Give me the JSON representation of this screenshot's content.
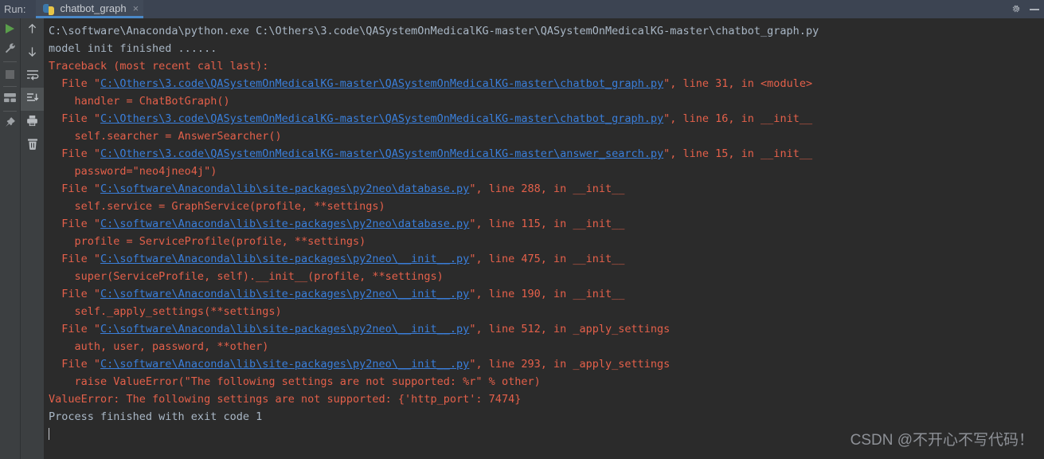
{
  "header": {
    "run_label": "Run:",
    "tab": {
      "label": "chatbot_graph",
      "close_glyph": "×",
      "icon_name": "python-file-icon"
    },
    "settings_icon": "gear-icon",
    "minimize_icon": "minimize-icon",
    "bg_color": "#3c4452",
    "tab_underline_color": "#4a88c7"
  },
  "toolbar_left": {
    "items": [
      {
        "name": "rerun-button",
        "icon": "play-icon"
      },
      {
        "name": "edit-configurations-button",
        "icon": "wrench-icon"
      },
      {
        "name": "stop-button",
        "icon": "stop-square-icon"
      },
      {
        "name": "layout-settings-button",
        "icon": "layout-icon"
      },
      {
        "name": "pin-tab-button",
        "icon": "pin-icon"
      }
    ]
  },
  "toolbar_console": {
    "items": [
      {
        "name": "up-the-stack-trace-button",
        "icon": "arrow-up-icon",
        "active": false
      },
      {
        "name": "down-the-stack-trace-button",
        "icon": "arrow-down-icon",
        "active": false
      },
      {
        "name": "soft-wrap-button",
        "icon": "soft-wrap-icon",
        "active": false
      },
      {
        "name": "scroll-to-end-button",
        "icon": "scroll-to-end-icon",
        "active": true
      },
      {
        "name": "print-button",
        "icon": "printer-icon",
        "active": false
      },
      {
        "name": "clear-all-button",
        "icon": "trash-icon",
        "active": false
      }
    ]
  },
  "console": {
    "bg_color": "#2b2b2b",
    "text_color": "#a9b7c6",
    "error_color": "#e4604a",
    "link_color": "#3a7fdb",
    "lines": [
      {
        "type": "info",
        "parts": [
          {
            "t": "C:\\software\\Anaconda\\python.exe C:\\Others\\3.code\\QASystemOnMedicalKG-master\\QASystemOnMedicalKG-master\\chatbot_graph.py"
          }
        ]
      },
      {
        "type": "info",
        "parts": [
          {
            "t": "model init finished ......"
          }
        ]
      },
      {
        "type": "err",
        "parts": [
          {
            "t": "Traceback (most recent call last):"
          }
        ]
      },
      {
        "type": "err",
        "parts": [
          {
            "t": "  File \""
          },
          {
            "t": "C:\\Others\\3.code\\QASystemOnMedicalKG-master\\QASystemOnMedicalKG-master\\chatbot_graph.py",
            "link": true
          },
          {
            "t": "\", line 31, in <module>"
          }
        ]
      },
      {
        "type": "err",
        "parts": [
          {
            "t": "    handler = ChatBotGraph()"
          }
        ]
      },
      {
        "type": "err",
        "parts": [
          {
            "t": "  File \""
          },
          {
            "t": "C:\\Others\\3.code\\QASystemOnMedicalKG-master\\QASystemOnMedicalKG-master\\chatbot_graph.py",
            "link": true
          },
          {
            "t": "\", line 16, in __init__"
          }
        ]
      },
      {
        "type": "err",
        "parts": [
          {
            "t": "    self.searcher = AnswerSearcher()"
          }
        ]
      },
      {
        "type": "err",
        "parts": [
          {
            "t": "  File \""
          },
          {
            "t": "C:\\Others\\3.code\\QASystemOnMedicalKG-master\\QASystemOnMedicalKG-master\\answer_search.py",
            "link": true
          },
          {
            "t": "\", line 15, in __init__"
          }
        ]
      },
      {
        "type": "err",
        "parts": [
          {
            "t": "    password=\"neo4jneo4j\")"
          }
        ]
      },
      {
        "type": "err",
        "parts": [
          {
            "t": "  File \""
          },
          {
            "t": "C:\\software\\Anaconda\\lib\\site-packages\\py2neo\\database.py",
            "link": true
          },
          {
            "t": "\", line 288, in __init__"
          }
        ]
      },
      {
        "type": "err",
        "parts": [
          {
            "t": "    self.service = GraphService(profile, **settings)"
          }
        ]
      },
      {
        "type": "err",
        "parts": [
          {
            "t": "  File \""
          },
          {
            "t": "C:\\software\\Anaconda\\lib\\site-packages\\py2neo\\database.py",
            "link": true
          },
          {
            "t": "\", line 115, in __init__"
          }
        ]
      },
      {
        "type": "err",
        "parts": [
          {
            "t": "    profile = ServiceProfile(profile, **settings)"
          }
        ]
      },
      {
        "type": "err",
        "parts": [
          {
            "t": "  File \""
          },
          {
            "t": "C:\\software\\Anaconda\\lib\\site-packages\\py2neo\\__init__.py",
            "link": true
          },
          {
            "t": "\", line 475, in __init__"
          }
        ]
      },
      {
        "type": "err",
        "parts": [
          {
            "t": "    super(ServiceProfile, self).__init__(profile, **settings)"
          }
        ]
      },
      {
        "type": "err",
        "parts": [
          {
            "t": "  File \""
          },
          {
            "t": "C:\\software\\Anaconda\\lib\\site-packages\\py2neo\\__init__.py",
            "link": true
          },
          {
            "t": "\", line 190, in __init__"
          }
        ]
      },
      {
        "type": "err",
        "parts": [
          {
            "t": "    self._apply_settings(**settings)"
          }
        ]
      },
      {
        "type": "err",
        "parts": [
          {
            "t": "  File \""
          },
          {
            "t": "C:\\software\\Anaconda\\lib\\site-packages\\py2neo\\__init__.py",
            "link": true
          },
          {
            "t": "\", line 512, in _apply_settings"
          }
        ]
      },
      {
        "type": "err",
        "parts": [
          {
            "t": "    auth, user, password, **other)"
          }
        ]
      },
      {
        "type": "err",
        "parts": [
          {
            "t": "  File \""
          },
          {
            "t": "C:\\software\\Anaconda\\lib\\site-packages\\py2neo\\__init__.py",
            "link": true
          },
          {
            "t": "\", line 293, in _apply_settings"
          }
        ]
      },
      {
        "type": "err",
        "parts": [
          {
            "t": "    raise ValueError(\"The following settings are not supported: %r\" % other)"
          }
        ]
      },
      {
        "type": "err",
        "parts": [
          {
            "t": "ValueError: The following settings are not supported: {'http_port': 7474}"
          }
        ]
      },
      {
        "type": "info",
        "parts": [
          {
            "t": ""
          }
        ]
      },
      {
        "type": "info",
        "parts": [
          {
            "t": ""
          }
        ]
      },
      {
        "type": "info",
        "parts": [
          {
            "t": "Process finished with exit code 1"
          }
        ]
      },
      {
        "type": "info",
        "parts": [
          {
            "t": "",
            "caret": true
          }
        ]
      }
    ]
  },
  "watermark": {
    "text": "CSDN @不开心不写代码！"
  }
}
